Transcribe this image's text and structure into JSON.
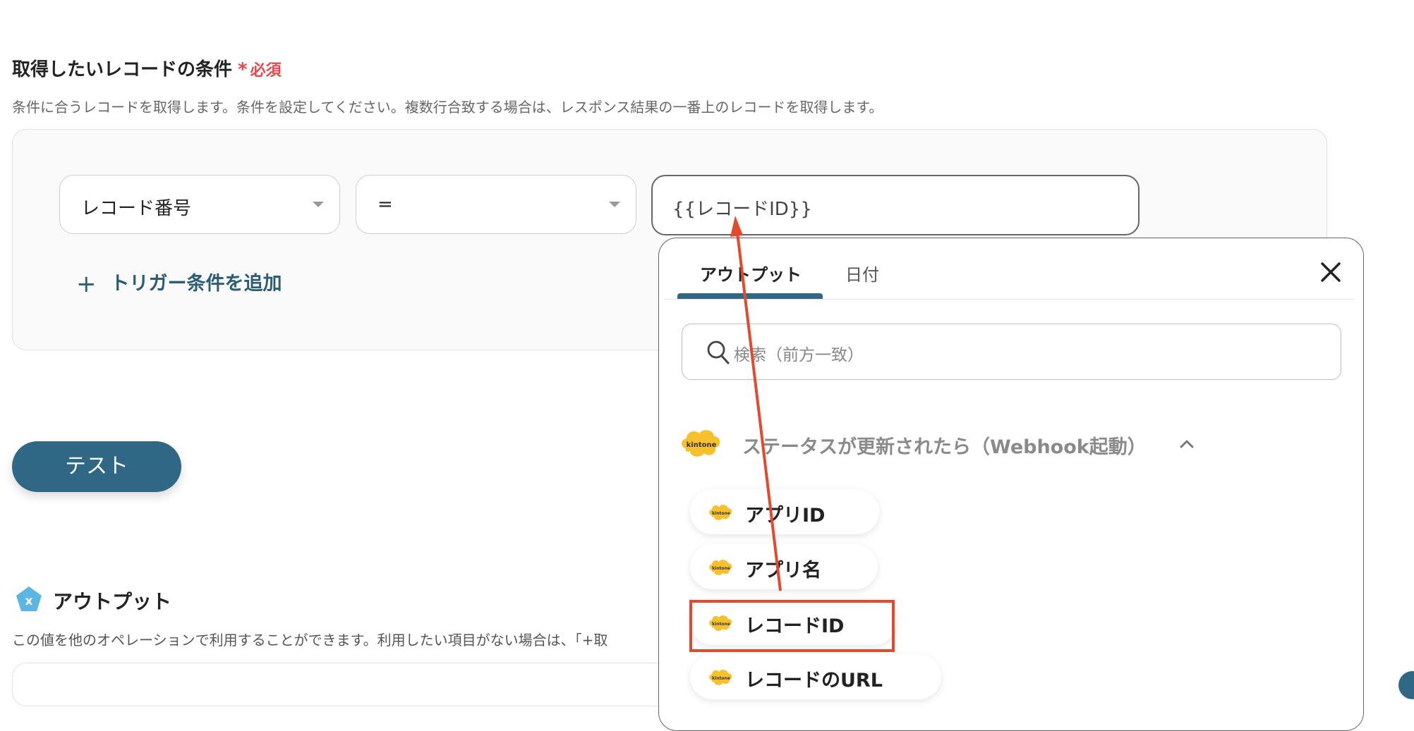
{
  "condition_section": {
    "title": "取得したいレコードの条件",
    "required_mark": "*",
    "required_text": "必須",
    "description": "条件に合うレコードを取得します。条件を設定してください。複数行合致する場合は、レスポンス結果の一番上のレコードを取得します。"
  },
  "condition_row": {
    "field_value": "レコード番号",
    "operator_value": "=",
    "value_text": "{{レコードID}}"
  },
  "add_condition_label": "トリガー条件を追加",
  "add_condition_icon": "+",
  "test_button_label": "テスト",
  "output_section": {
    "title": "アウトプット",
    "icon": "x",
    "description": "この値を他のオペレーションで利用することができます。利用したい項目がない場合は、「+取"
  },
  "dropdown": {
    "tabs": [
      {
        "label": "アウトプット"
      },
      {
        "label": "日付"
      }
    ],
    "search_placeholder": "検索（前方一致）",
    "group": {
      "logo_text": "kintone",
      "title": "ステータスが更新されたら（Webhook起動）"
    },
    "items": [
      {
        "label": "アプリID",
        "logo_text": "kintone"
      },
      {
        "label": "アプリ名",
        "logo_text": "kintone"
      },
      {
        "label": "レコードID",
        "logo_text": "kintone"
      },
      {
        "label": "レコードのURL",
        "logo_text": "kintone"
      }
    ]
  },
  "colors": {
    "accent": "#306785",
    "required": "#e5484d",
    "highlight": "#e34a2b",
    "kintone_yellow": "#f7c02d"
  }
}
